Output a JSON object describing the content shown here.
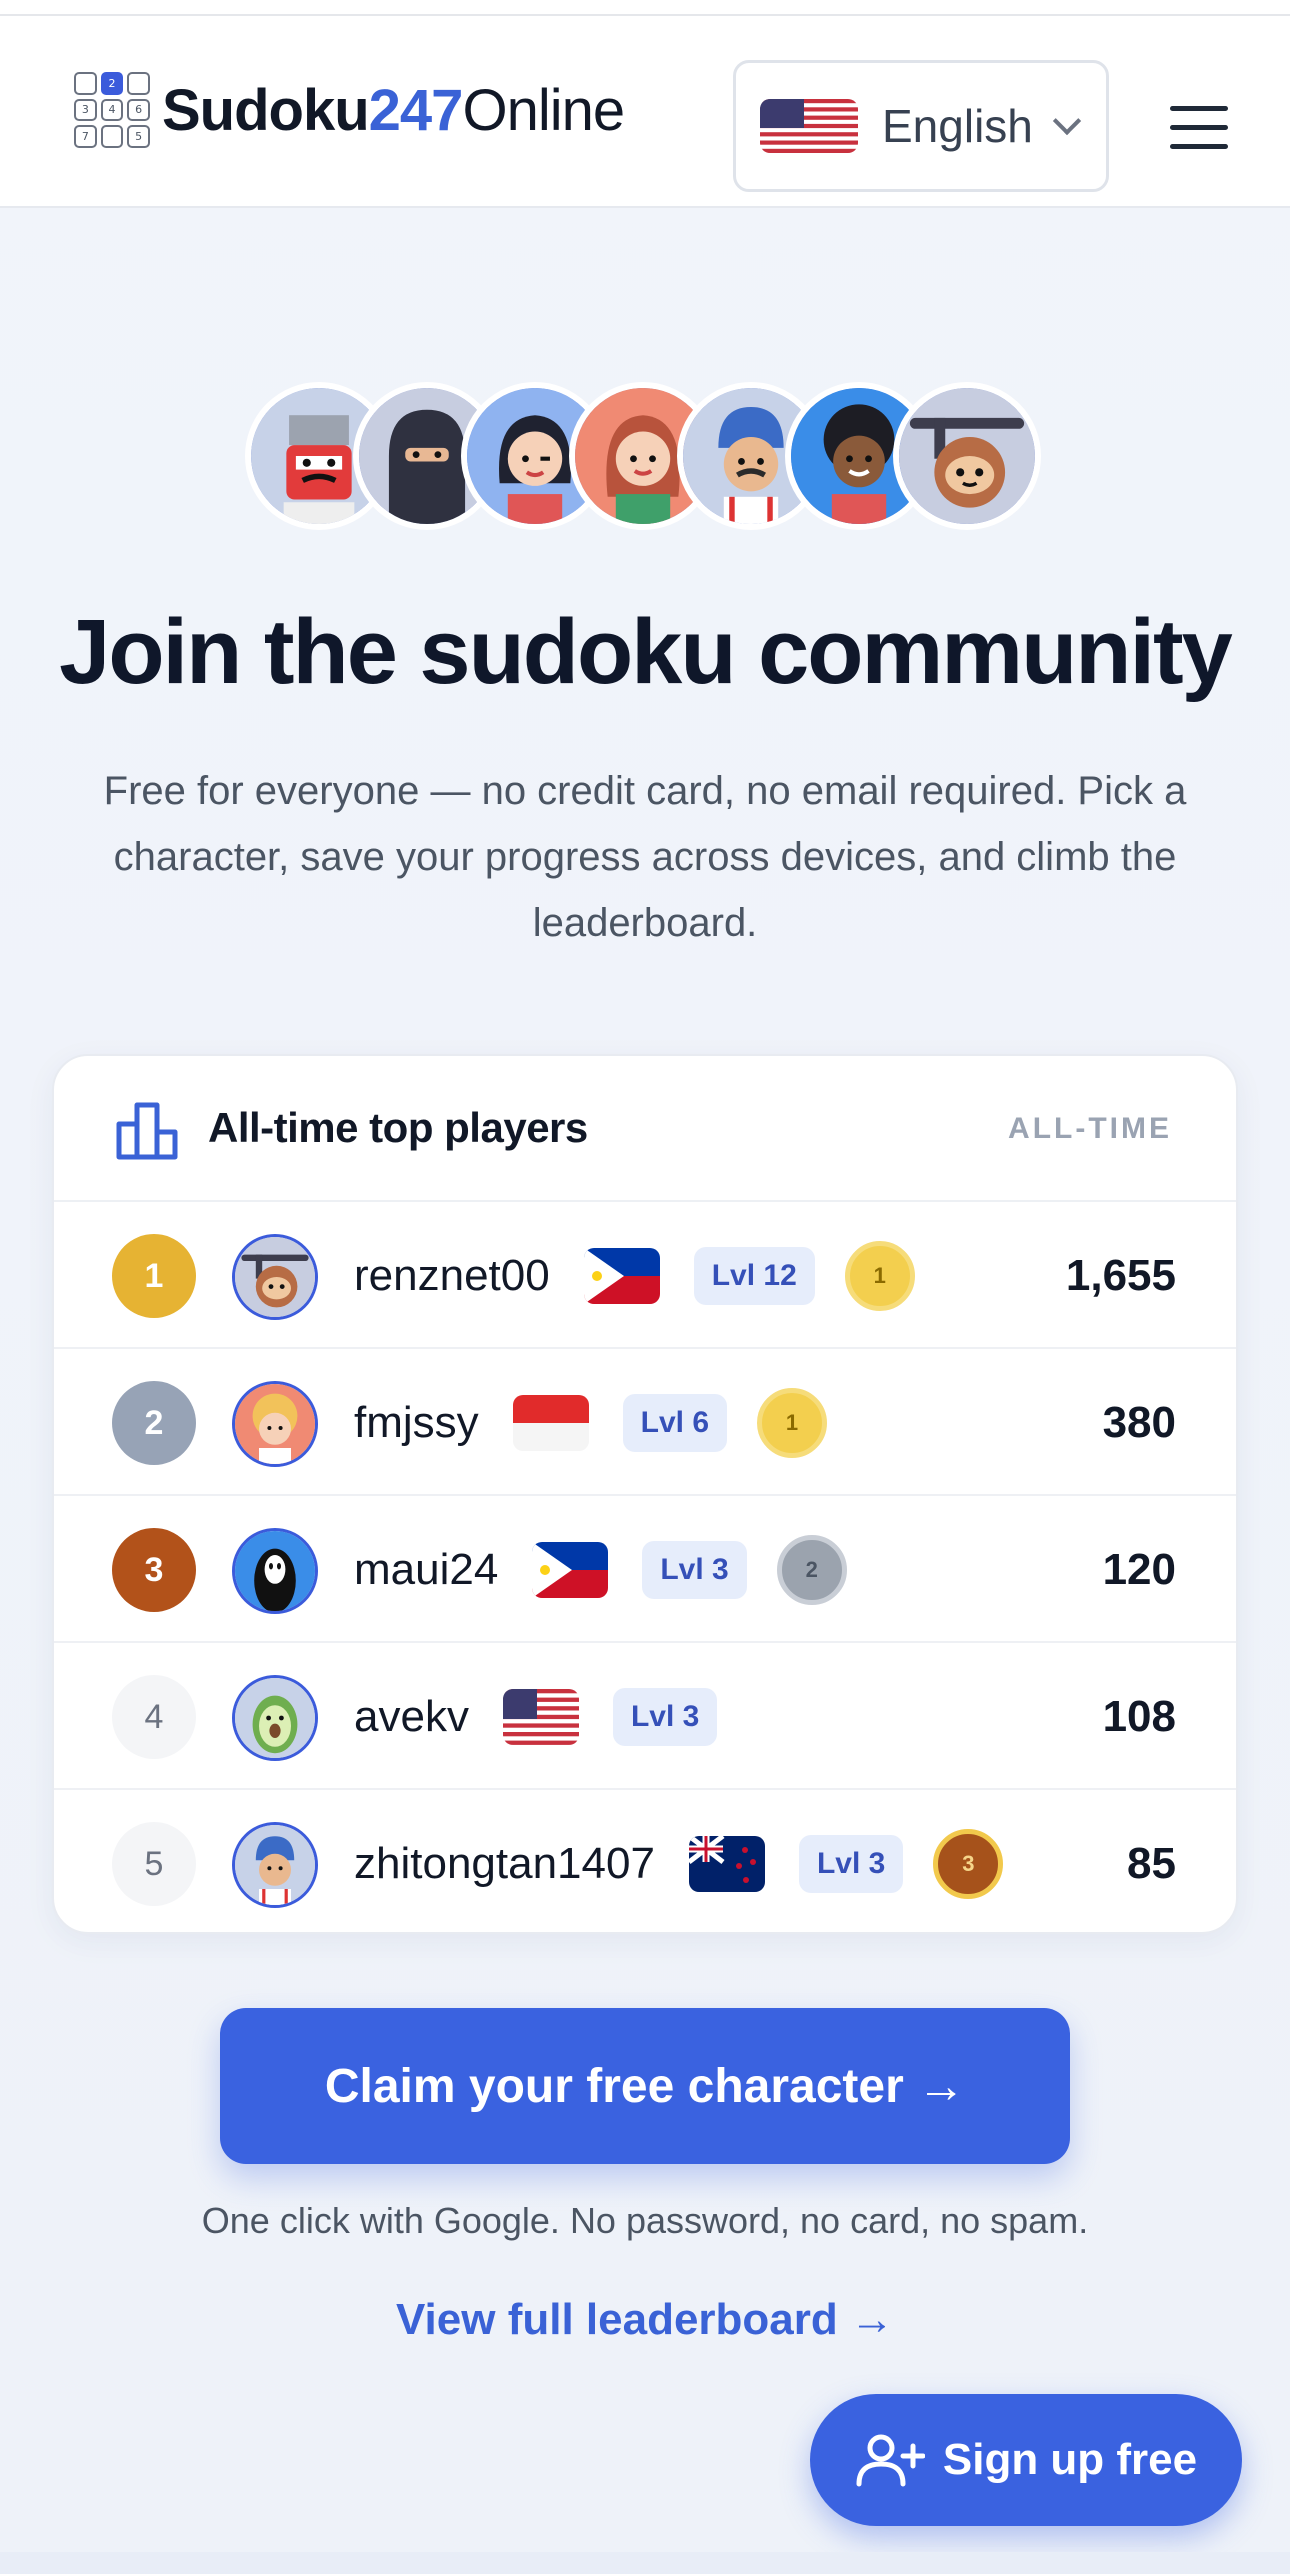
{
  "header": {
    "logo": {
      "part1": "Sudoku",
      "part2": "247",
      "part3": "Online",
      "grid_digits": [
        "",
        "2",
        "",
        "3",
        "4",
        "6",
        "7",
        "",
        "5"
      ]
    },
    "language": {
      "label": "English",
      "flag": "us-flag-icon"
    }
  },
  "hero": {
    "title": "Join the sudoku community",
    "subtitle": "Free for everyone — no credit card, no email required. Pick a character, save your progress across devices, and climb the leaderboard."
  },
  "leaderboard": {
    "title": "All-time top players",
    "badge": "ALL-TIME",
    "rows": [
      {
        "rank": "1",
        "name": "renznet00",
        "flag": "ph-flag-icon",
        "level": "Lvl 12",
        "medal": "1",
        "score": "1,655"
      },
      {
        "rank": "2",
        "name": "fmjssy",
        "flag": "id-flag-icon",
        "level": "Lvl 6",
        "medal": "1",
        "score": "380"
      },
      {
        "rank": "3",
        "name": "maui24",
        "flag": "ph-flag-icon",
        "level": "Lvl 3",
        "medal": "2",
        "score": "120"
      },
      {
        "rank": "4",
        "name": "avekv",
        "flag": "us-flag-icon",
        "level": "Lvl 3",
        "medal": "",
        "score": "108"
      },
      {
        "rank": "5",
        "name": "zhitongtan1407",
        "flag": "nz-flag-icon",
        "level": "Lvl 3",
        "medal": "3",
        "score": "85"
      }
    ]
  },
  "cta": {
    "button": "Claim your free character →",
    "note": "One click with Google. No password, no card, no spam.",
    "link": "View full leaderboard →"
  },
  "floating": {
    "signup": "Sign up free"
  },
  "colors": {
    "accent": "#3a62e0",
    "gold": "#e6b333",
    "silver": "#97a3b6",
    "bronze": "#b2521a"
  }
}
